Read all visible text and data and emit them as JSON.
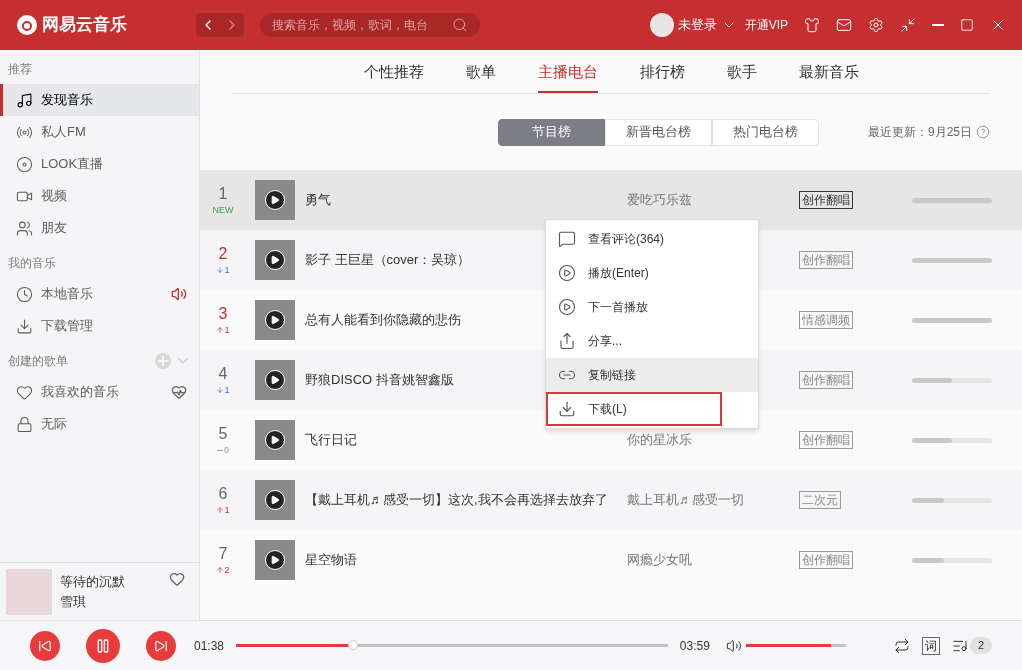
{
  "header": {
    "logo_text": "网易云音乐",
    "search": {
      "placeholder": "搜索音乐，视频，歌词，电台"
    },
    "user": "未登录",
    "vip": "开通VIP"
  },
  "sidebar": {
    "sections": [
      {
        "title": "推荐",
        "items": [
          {
            "label": "发现音乐",
            "kind": "music",
            "selected": true
          },
          {
            "label": "私人FM",
            "kind": "radio",
            "selected": false
          },
          {
            "label": "LOOK直播",
            "kind": "live",
            "selected": false
          },
          {
            "label": "视频",
            "kind": "video",
            "selected": false
          },
          {
            "label": "朋友",
            "kind": "friends",
            "selected": false
          }
        ]
      },
      {
        "title": "我的音乐",
        "items": [
          {
            "label": "本地音乐",
            "kind": "local",
            "selected": false,
            "playing": true
          },
          {
            "label": "下载管理",
            "kind": "download",
            "selected": false
          }
        ]
      },
      {
        "title": "创建的歌单",
        "addable": true,
        "items": [
          {
            "label": "我喜欢的音乐",
            "kind": "heart",
            "selected": false,
            "heartbeat": true
          },
          {
            "label": "无际",
            "kind": "lock",
            "selected": false
          }
        ]
      }
    ]
  },
  "now_playing": {
    "title": "等待的沉默",
    "artist": "雪琪"
  },
  "tabs": [
    {
      "label": "个性推荐",
      "selected": false
    },
    {
      "label": "歌单",
      "selected": false
    },
    {
      "label": "主播电台",
      "selected": true
    },
    {
      "label": "排行榜",
      "selected": false
    },
    {
      "label": "歌手",
      "selected": false
    },
    {
      "label": "最新音乐",
      "selected": false
    }
  ],
  "chart_tabs": [
    {
      "label": "节目榜",
      "selected": true
    },
    {
      "label": "新晋电台榜",
      "selected": false
    },
    {
      "label": "热门电台榜",
      "selected": false
    }
  ],
  "last_update": "最近更新：9月25日",
  "rows": [
    {
      "rank": "1",
      "rank_hot": false,
      "change": "NEW",
      "kind": "new",
      "title": "勇气",
      "author": "爱吃巧乐兹",
      "tag": "创作翻唱",
      "level": 1,
      "selected": true
    },
    {
      "rank": "2",
      "rank_hot": true,
      "change": "1",
      "kind": "down",
      "title": "影子 王巨星（cover：吴琼）",
      "tag": "创作翻唱",
      "level": 1,
      "selected": false
    },
    {
      "rank": "3",
      "rank_hot": true,
      "change": "1",
      "kind": "up",
      "title": "总有人能看到你隐藏的悲伤",
      "tag": "情感调频",
      "level": 1,
      "selected": false
    },
    {
      "rank": "4",
      "rank_hot": false,
      "change": "1",
      "kind": "down",
      "title": "野狼DISCO 抖音姚智鑫版",
      "tag": "创作翻唱",
      "level": 0.5,
      "selected": false
    },
    {
      "rank": "5",
      "rank_hot": false,
      "change": "0",
      "kind": "flat",
      "title": "飞行日记",
      "author": "你的星冰乐",
      "tag": "创作翻唱",
      "level": 0.5,
      "selected": false
    },
    {
      "rank": "6",
      "rank_hot": false,
      "change": "1",
      "kind": "up",
      "title": "【戴上耳机♬感受一切】这次,我不会再选择去放弃了",
      "author": "戴上耳机♬感受一切",
      "tag": "二次元",
      "level": 0.4,
      "selected": false
    },
    {
      "rank": "7",
      "rank_hot": false,
      "change": "2",
      "kind": "up",
      "title": "星空物语",
      "author": "网瘾少女吼",
      "tag": "创作翻唱",
      "level": 0.4,
      "selected": false
    }
  ],
  "context_menu": [
    {
      "label": "查看评论(364)",
      "kind": "comment",
      "selected": false,
      "outlined": false
    },
    {
      "label": "播放(Enter)",
      "kind": "play",
      "selected": false,
      "outlined": false
    },
    {
      "label": "下一首播放",
      "kind": "next",
      "selected": false,
      "outlined": false
    },
    {
      "label": "分享...",
      "kind": "share",
      "selected": false,
      "outlined": false
    },
    {
      "label": "复制链接",
      "kind": "link",
      "selected": true,
      "outlined": false
    },
    {
      "label": "下载(L)",
      "kind": "download",
      "selected": false,
      "outlined": true
    }
  ],
  "player": {
    "elapsed": "01:38",
    "duration": "03:59",
    "level": 0.27,
    "volume": {
      "level": 0.85
    },
    "lyrics_button": "词",
    "playlist_count": "2"
  }
}
